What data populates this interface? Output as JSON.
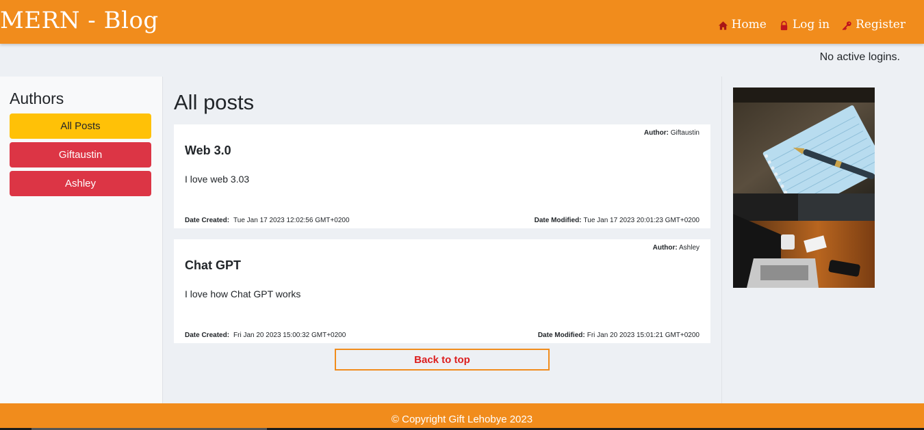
{
  "header": {
    "brand": "MERN - Blog",
    "nav": [
      {
        "label": "Home",
        "icon": "home-icon"
      },
      {
        "label": "Log in",
        "icon": "lock-icon"
      },
      {
        "label": "Register",
        "icon": "key-icon"
      }
    ]
  },
  "login_status": "No active logins.",
  "sidebar": {
    "title": "Authors",
    "items": [
      {
        "label": "All Posts"
      },
      {
        "label": "Giftaustin"
      },
      {
        "label": "Ashley"
      }
    ]
  },
  "main": {
    "title": "All posts",
    "posts": [
      {
        "author_label": "Author:",
        "author": "Giftaustin",
        "title": "Web 3.0",
        "body": "I love web 3.03",
        "created_label": "Date Created:",
        "created": "Tue Jan 17 2023 12:02:56 GMT+0200",
        "modified_label": "Date Modified:",
        "modified": "Tue Jan 17 2023 20:01:23 GMT+0200"
      },
      {
        "author_label": "Author:",
        "author": "Ashley",
        "title": "Chat GPT",
        "body": "I love how Chat GPT works",
        "created_label": "Date Created:",
        "created": "Fri Jan 20 2023 15:00:32 GMT+0200",
        "modified_label": "Date Modified:",
        "modified": "Fri Jan 20 2023 15:01:21 GMT+0200"
      }
    ],
    "back_to_top": "Back to top"
  },
  "aside": {
    "images": [
      "notebook-with-fountain-pen",
      "laptop-on-wooden-desk"
    ]
  },
  "footer": {
    "text": "© Copyright Gift Lehobye 2023"
  },
  "colors": {
    "brand_orange": "#f18c1c",
    "warning": "#ffc107",
    "danger": "#dc3545",
    "back_to_top_text": "#dc1e1e",
    "icon_red": "#c0141e"
  }
}
